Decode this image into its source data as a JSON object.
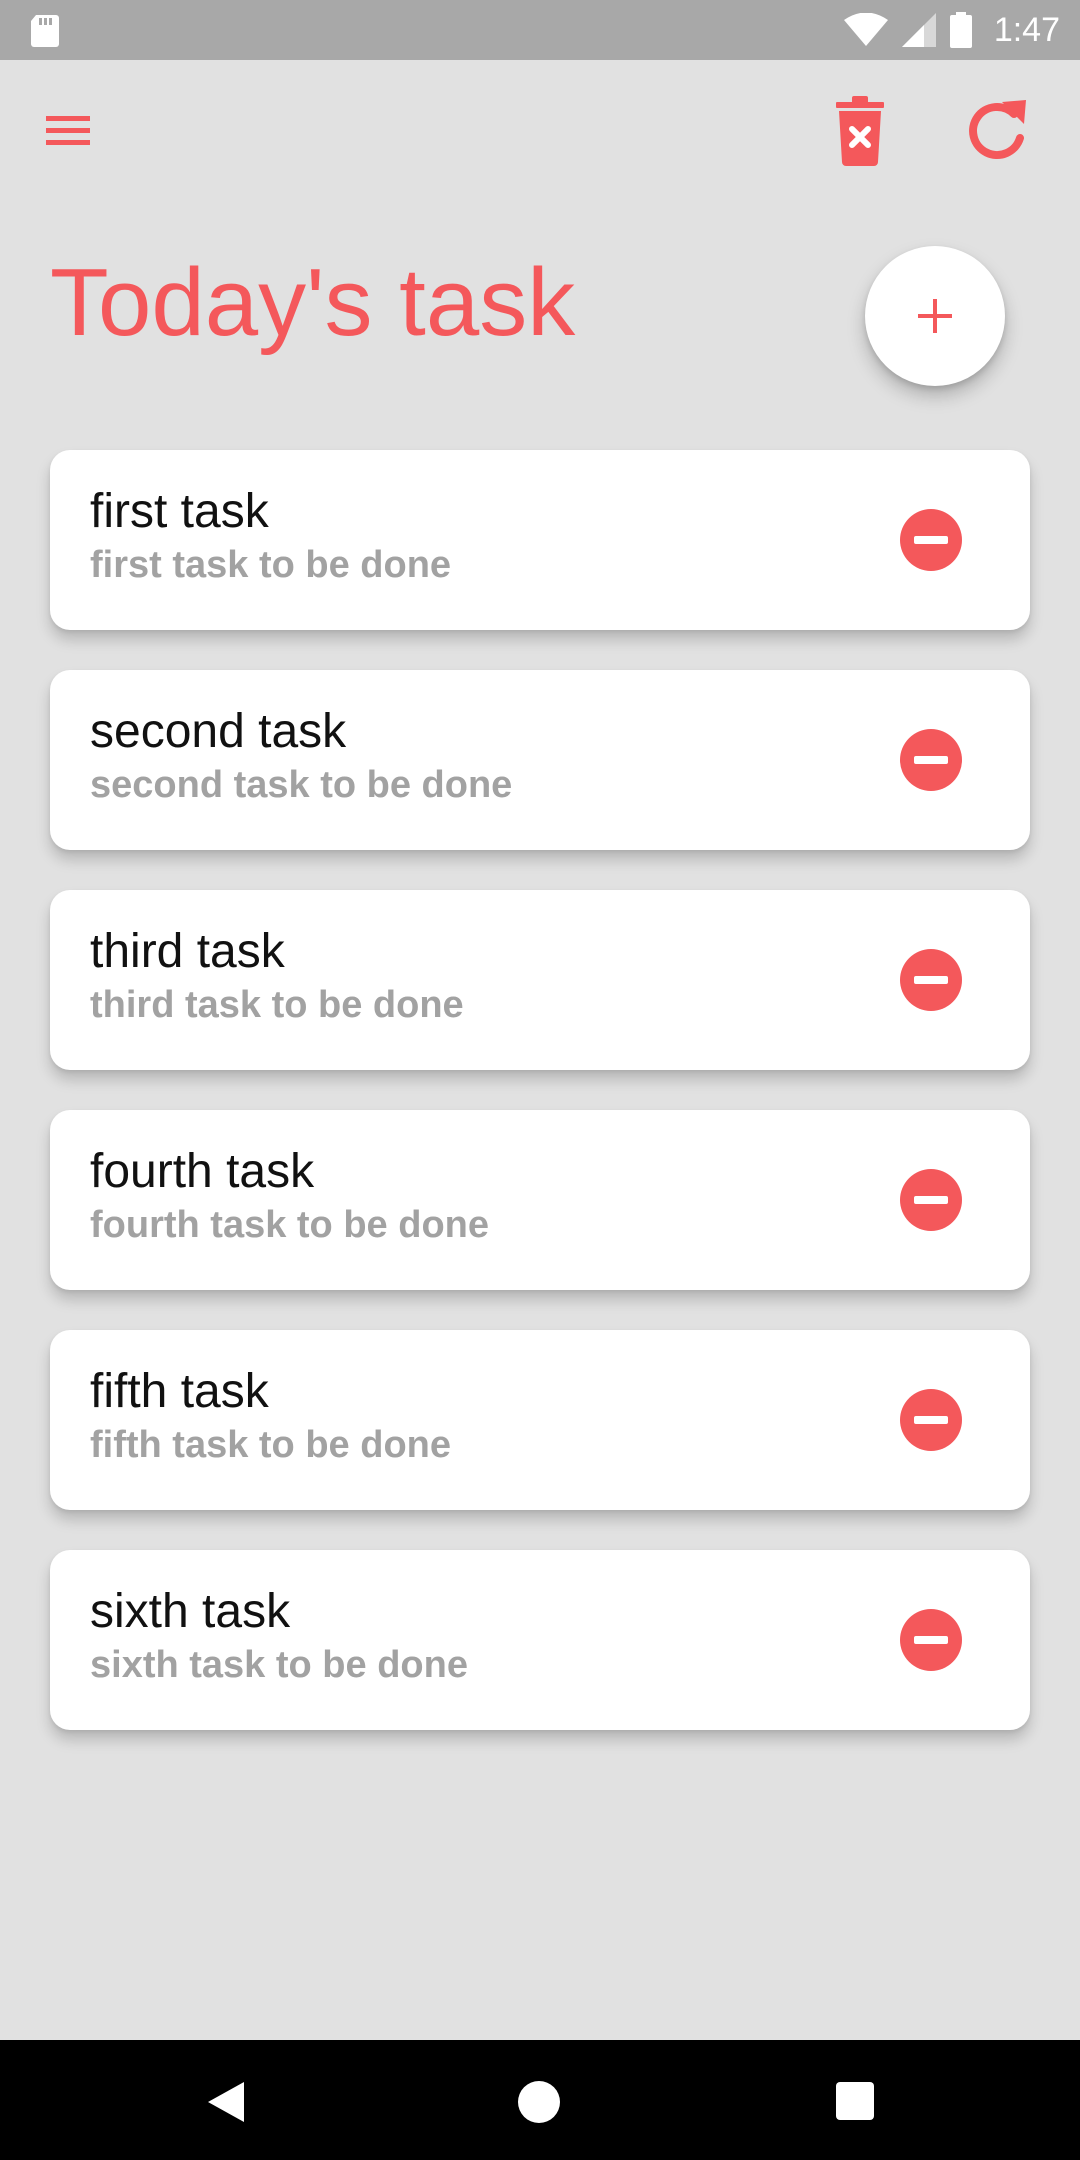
{
  "status_bar": {
    "time": "1:47",
    "icons": [
      "sd-card-icon",
      "wifi-icon",
      "cell-signal-icon",
      "battery-icon"
    ]
  },
  "toolbar": {
    "icons": [
      "menu-icon",
      "trash-icon",
      "refresh-icon"
    ]
  },
  "page": {
    "title": "Today's task",
    "add_label": "+"
  },
  "tasks": [
    {
      "title": "first task",
      "subtitle": "first task to be done"
    },
    {
      "title": "second task",
      "subtitle": "second task to be done"
    },
    {
      "title": "third task",
      "subtitle": "third task to be done"
    },
    {
      "title": "fourth task",
      "subtitle": "fourth task to be done"
    },
    {
      "title": "fifth task",
      "subtitle": "fifth task to be done"
    },
    {
      "title": "sixth task",
      "subtitle": "sixth task to be done"
    }
  ],
  "nav_bar": {
    "icons": [
      "back-icon",
      "home-icon",
      "recents-icon"
    ]
  },
  "colors": {
    "accent": "#f4585b",
    "background": "#e1e1e1",
    "status_bar": "#a8a8a8",
    "card": "#ffffff",
    "subtitle": "#a2a2a2"
  }
}
